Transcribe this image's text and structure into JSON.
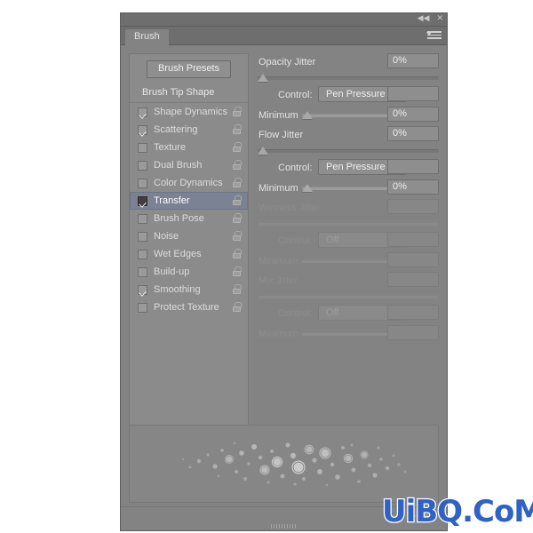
{
  "window": {
    "titlebar": {
      "collapse_icon": "double-left-arrow-icon",
      "collapse_glyph": "◀◀",
      "close_icon": "close-icon",
      "close_glyph": "✕"
    },
    "tab": {
      "label": "Brush"
    },
    "panel_menu_icon": "panel-menu-icon"
  },
  "sidebar": {
    "presets_button": "Brush Presets",
    "tip_shape_label": "Brush Tip Shape",
    "lock_icon": "open-padlock-icon",
    "items": [
      {
        "label": "Shape Dynamics",
        "checked": true,
        "selected": false
      },
      {
        "label": "Scattering",
        "checked": true,
        "selected": false
      },
      {
        "label": "Texture",
        "checked": false,
        "selected": false
      },
      {
        "label": "Dual Brush",
        "checked": false,
        "selected": false
      },
      {
        "label": "Color Dynamics",
        "checked": false,
        "selected": false
      },
      {
        "label": "Transfer",
        "checked": true,
        "selected": true
      },
      {
        "label": "Brush Pose",
        "checked": false,
        "selected": false
      },
      {
        "label": "Noise",
        "checked": false,
        "selected": false
      },
      {
        "label": "Wet Edges",
        "checked": false,
        "selected": false
      },
      {
        "label": "Build-up",
        "checked": false,
        "selected": false
      },
      {
        "label": "Smoothing",
        "checked": true,
        "selected": false
      },
      {
        "label": "Protect Texture",
        "checked": false,
        "selected": false
      }
    ]
  },
  "transfer_panel": {
    "control_label": "Control:",
    "minimum_label": "Minimum",
    "groups": [
      {
        "name": "opacity-jitter",
        "title": "Opacity Jitter",
        "value": "0%",
        "slider_percent": 0,
        "control_value": "Pen Pressure",
        "minimum_value": "0%",
        "minimum_percent": 0,
        "enabled": true
      },
      {
        "name": "flow-jitter",
        "title": "Flow Jitter",
        "value": "0%",
        "slider_percent": 0,
        "control_value": "Pen Pressure",
        "minimum_value": "0%",
        "minimum_percent": 0,
        "enabled": true
      },
      {
        "name": "wetness-jitter",
        "title": "Wetness Jitter",
        "value": "",
        "slider_percent": 0,
        "control_value": "Off",
        "minimum_value": "",
        "minimum_percent": 0,
        "enabled": false
      },
      {
        "name": "mix-jitter",
        "title": "Mix Jitter",
        "value": "",
        "slider_percent": 0,
        "control_value": "Off",
        "minimum_value": "",
        "minimum_percent": 0,
        "enabled": false
      }
    ]
  },
  "preview": {
    "name": "brush-stroke-preview"
  },
  "footer": {
    "create_brush_icon": "new-brush-icon",
    "resize_grip_icon": "resize-grip-icon"
  },
  "watermark": {
    "text": "UiBQ.CoM",
    "color": "#2f62c4"
  },
  "colors": {
    "panel_bg": "#838383",
    "titlebar_bg": "#6e6e6e",
    "selection_bg": "#7a8293",
    "text": "#e3e3e3",
    "disabled_text": "#8d8d8d"
  }
}
